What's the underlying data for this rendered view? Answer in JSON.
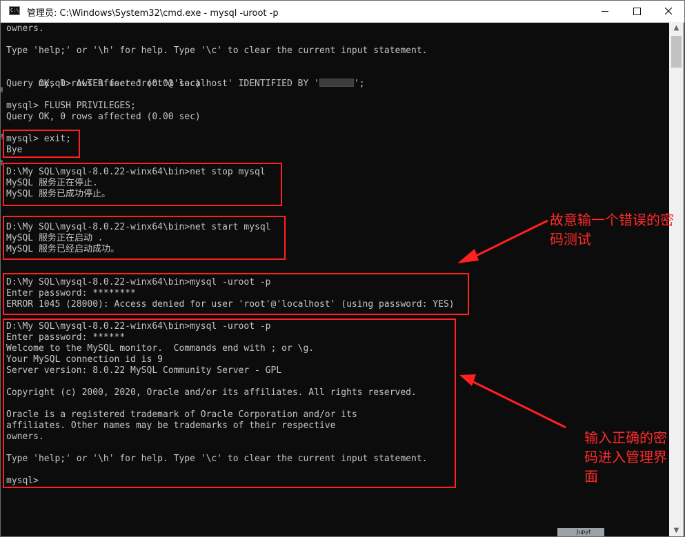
{
  "window": {
    "title": "管理员: C:\\Windows\\System32\\cmd.exe - mysql  -uroot -p",
    "icon_label": "C:\\",
    "controls": [
      "minimize-icon",
      "maximize-icon",
      "close-icon"
    ]
  },
  "terminal": {
    "lines": [
      "owners.",
      "",
      "Type 'help;' or '\\h' for help. Type '\\c' to clear the current input statement.",
      "",
      "mysql> ALTER user 'root'@'localhost' IDENTIFIED BY '",
      "Query OK, 0 rows affected (0.01 sec)",
      "",
      "mysql> FLUSH PRIVILEGES;",
      "Query OK, 0 rows affected (0.00 sec)",
      "",
      "mysql> exit;",
      "Bye",
      "",
      "D:\\My SQL\\mysql-8.0.22-winx64\\bin>net stop mysql",
      "MySQL 服务正在停止.",
      "MySQL 服务已成功停止。",
      "",
      "",
      "D:\\My SQL\\mysql-8.0.22-winx64\\bin>net start mysql",
      "MySQL 服务正在启动 .",
      "MySQL 服务已经启动成功。",
      "",
      "",
      "D:\\My SQL\\mysql-8.0.22-winx64\\bin>mysql -uroot -p",
      "Enter password: ********",
      "ERROR 1045 (28000): Access denied for user 'root'@'localhost' (using password: YES)",
      "",
      "D:\\My SQL\\mysql-8.0.22-winx64\\bin>mysql -uroot -p",
      "Enter password: ******",
      "Welcome to the MySQL monitor.  Commands end with ; or \\g.",
      "Your MySQL connection id is 9",
      "Server version: 8.0.22 MySQL Community Server - GPL",
      "",
      "Copyright (c) 2000, 2020, Oracle and/or its affiliates. All rights reserved.",
      "",
      "Oracle is a registered trademark of Oracle Corporation and/or its",
      "affiliates. Other names may be trademarks of their respective",
      "owners.",
      "",
      "Type 'help;' or '\\h' for help. Type '\\c' to clear the current input statement.",
      "",
      "mysql>"
    ],
    "redacted_suffix": "';"
  },
  "annotations": {
    "wrong_password_note": "故意输一个错误的密\n码测试",
    "correct_password_note": "输入正确的密\n码进入管理界\n面"
  },
  "edge_fragments": [
    "器",
    "参",
    "管"
  ],
  "taskbar_fragment": "Jupyt"
}
